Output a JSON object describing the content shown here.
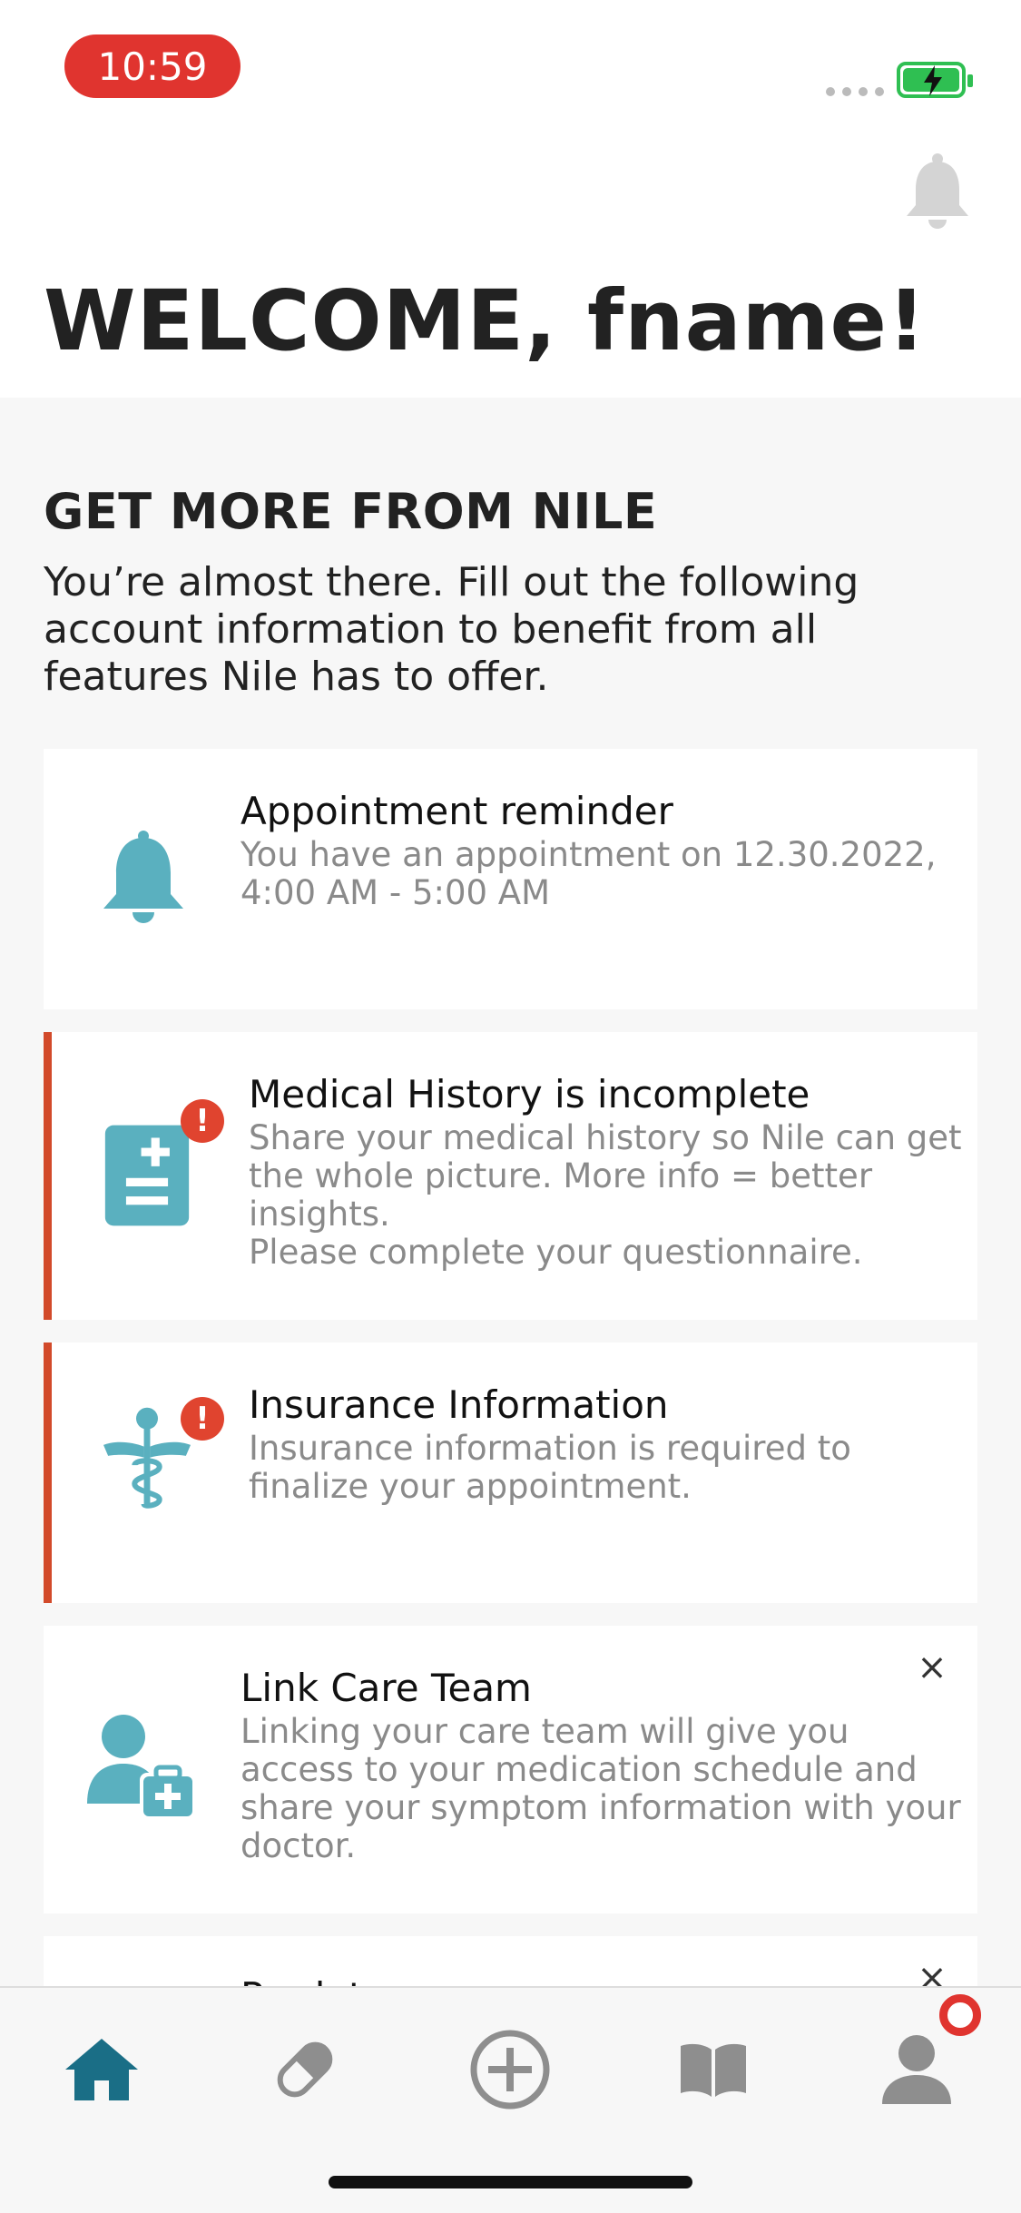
{
  "status_bar": {
    "time": "10:59"
  },
  "header": {
    "welcome": "WELCOME, fname!"
  },
  "section": {
    "title": "GET MORE FROM NILE",
    "description": "You’re almost there. Fill out the following account information to benefit from all features Nile has to offer."
  },
  "cards": [
    {
      "title": "Appointment reminder",
      "text": "You have an appointment on 12.30.2022, 4:00 AM - 5:00 AM",
      "icon": "bell-icon"
    },
    {
      "title": "Medical History is incomplete",
      "text": "Share your medical history so Nile can get the whole picture. More info = better insights.\nPlease complete your questionnaire.",
      "icon": "medical-record-icon",
      "badge": "!"
    },
    {
      "title": "Insurance Information",
      "text": "Insurance information is required to finalize your appointment.",
      "icon": "caduceus-icon",
      "badge": "!"
    },
    {
      "title": "Link Care Team",
      "text": "Linking your care team will give you access to your medication schedule and share your symptom information with your doctor.",
      "icon": "care-team-icon",
      "close": "×"
    },
    {
      "title": "Prodatu",
      "close": "×"
    }
  ],
  "tab_bar": {
    "tabs": [
      "home-icon",
      "pill-icon",
      "add-icon",
      "book-icon",
      "profile-icon"
    ]
  },
  "colors": {
    "accent": "#5ab0bf",
    "alert": "#d24a2a",
    "nav_active": "#1a6e86",
    "nav_inactive": "#8e8e8e"
  }
}
